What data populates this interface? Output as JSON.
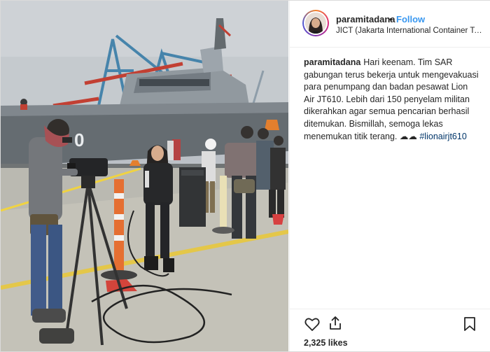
{
  "post": {
    "username": "paramitadana",
    "separator": "•",
    "follow_label": "Follow",
    "location": "JICT (Jakarta International Container Termi...",
    "caption": {
      "username": "paramitadana",
      "text": "Hari keenam. Tim SAR gabungan terus bekerja untuk mengevakuasi para penumpang dan badan pesawat Lion Air JT610. Lebih dari 150 penyelam militan dikerahkan agar semua pencarian berhasil ditemukan. Bismillah, semoga lekas menemukan titik terang. ☁☁",
      "hashtag": "#lionairjt610"
    },
    "likes": "2,325 likes",
    "photo": {
      "ship_hull_number": "0"
    }
  },
  "icons": {
    "like": "heart-icon",
    "share": "share-icon",
    "save": "bookmark-icon"
  },
  "colors": {
    "accent": "#3897f0",
    "hashtag": "#003569",
    "text": "#262626",
    "border": "#dbdbdb"
  }
}
